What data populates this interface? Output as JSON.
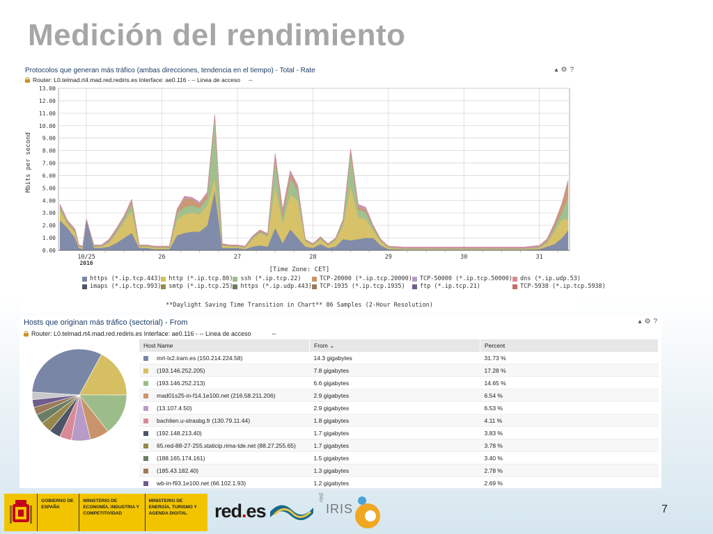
{
  "slide": {
    "title": "Medición del rendimiento",
    "page_number": "7"
  },
  "panel1": {
    "title": "Protocolos que generan más tráfico (ambas direcciones, tendencia en el tiempo) - Total - Rate",
    "router": "Router: L0.telmad.rt4.mad.red.rediris.es Interface: ae0.116 - -- Linea de acceso",
    "router_extra": "--",
    "tools": [
      "▴",
      "⚙",
      "?"
    ]
  },
  "chart_data": {
    "type": "area",
    "ylabel": "Mbits per second",
    "xlabel": "[Time Zone: CET]",
    "note": "**Daylight Saving Time Transition in Chart** 86 Samples (2-Hour Resolution)",
    "ylim": [
      0,
      13
    ],
    "yticks": [
      "0.00",
      "1.00",
      "2.00",
      "3.00",
      "4.00",
      "5.00",
      "6.00",
      "7.00",
      "8.00",
      "9.00",
      "10.00",
      "11.00",
      "12.00",
      "13.00"
    ],
    "xticks": [
      {
        "t": 0,
        "label": "10/25",
        "sub": "2016"
      },
      {
        "t": 1,
        "label": "26"
      },
      {
        "t": 2,
        "label": "27"
      },
      {
        "t": 3,
        "label": "28"
      },
      {
        "t": 4,
        "label": "29"
      },
      {
        "t": 5,
        "label": "30"
      },
      {
        "t": 6,
        "label": "31"
      }
    ],
    "x": [
      -0.35,
      -0.25,
      -0.15,
      -0.1,
      -0.05,
      0.0,
      0.1,
      0.2,
      0.3,
      0.4,
      0.5,
      0.6,
      0.7,
      0.8,
      0.9,
      1.0,
      1.1,
      1.2,
      1.3,
      1.4,
      1.5,
      1.6,
      1.7,
      1.8,
      1.9,
      2.0,
      2.1,
      2.2,
      2.3,
      2.4,
      2.5,
      2.6,
      2.7,
      2.8,
      2.9,
      3.0,
      3.1,
      3.2,
      3.3,
      3.4,
      3.5,
      3.6,
      3.7,
      3.8,
      3.9,
      4.0,
      4.2,
      4.4,
      4.6,
      4.8,
      5.0,
      5.2,
      5.4,
      5.6,
      5.8,
      6.0,
      6.1,
      6.2,
      6.3,
      6.38
    ],
    "series": [
      {
        "name": "https (*.ip.tcp.443)",
        "color": "#7a86a6",
        "values": [
          2.4,
          1.8,
          1.0,
          0.2,
          0.1,
          2.5,
          0.2,
          0.2,
          0.3,
          0.6,
          1.0,
          1.4,
          0.2,
          0.2,
          0.1,
          0.1,
          0.1,
          1.2,
          1.4,
          1.5,
          1.5,
          2.0,
          4.8,
          0.2,
          0.2,
          0.2,
          0.1,
          0.3,
          0.4,
          0.3,
          1.8,
          0.6,
          1.7,
          1.0,
          0.3,
          0.2,
          0.5,
          0.2,
          0.3,
          0.9,
          0.8,
          0.9,
          1.0,
          1.0,
          0.4,
          0.1,
          0.05,
          0.05,
          0.05,
          0.05,
          0.05,
          0.05,
          0.05,
          0.05,
          0.05,
          0.1,
          0.3,
          0.5,
          1.0,
          1.6
        ]
      },
      {
        "name": "http (*.ip.tcp.80)",
        "color": "#d6bf62",
        "values": [
          0.8,
          0.3,
          0.4,
          0.1,
          0.1,
          0.0,
          0.1,
          0.1,
          0.3,
          0.8,
          1.3,
          1.8,
          0.1,
          0.1,
          0.1,
          0.1,
          0.1,
          1.3,
          1.5,
          1.5,
          1.4,
          1.6,
          1.0,
          0.2,
          0.1,
          0.1,
          0.1,
          0.6,
          1.0,
          0.8,
          3.4,
          1.6,
          2.8,
          3.0,
          0.4,
          0.2,
          0.4,
          0.2,
          0.5,
          1.1,
          4.4,
          1.8,
          1.5,
          0.6,
          0.3,
          0.1,
          0.05,
          0.05,
          0.05,
          0.05,
          0.05,
          0.05,
          0.05,
          0.05,
          0.05,
          0.1,
          0.3,
          1.0,
          1.5,
          0.9
        ]
      },
      {
        "name": "ssh (*.ip.tcp.22)",
        "color": "#9cbd8a",
        "values": [
          0.3,
          0.1,
          0.1,
          0.05,
          0.05,
          0.0,
          0.05,
          0.05,
          0.1,
          0.2,
          0.3,
          0.6,
          0.05,
          0.05,
          0.05,
          0.05,
          0.05,
          0.5,
          0.6,
          0.6,
          0.5,
          0.6,
          4.9,
          0.05,
          0.05,
          0.05,
          0.05,
          0.1,
          0.1,
          0.1,
          2.2,
          0.5,
          1.3,
          0.8,
          0.1,
          0.05,
          0.1,
          0.05,
          0.1,
          0.3,
          2.6,
          0.6,
          0.6,
          0.2,
          0.1,
          0.05,
          0.05,
          0.05,
          0.05,
          0.05,
          0.05,
          0.05,
          0.05,
          0.05,
          0.05,
          0.05,
          0.1,
          0.3,
          0.6,
          1.8
        ]
      },
      {
        "name": "TCP-20000 (*.ip.tcp.20000)",
        "color": "#c9946c",
        "values": [
          0.1,
          0.1,
          0.1,
          0.05,
          0.05,
          0.0,
          0.05,
          0.05,
          0.1,
          0.1,
          0.1,
          0.2,
          0.05,
          0.05,
          0.05,
          0.05,
          0.05,
          0.2,
          0.7,
          0.5,
          0.3,
          0.3,
          0.1,
          0.05,
          0.05,
          0.05,
          0.05,
          0.05,
          0.05,
          0.05,
          0.2,
          0.3,
          0.3,
          0.2,
          0.05,
          0.05,
          0.05,
          0.05,
          0.05,
          0.1,
          0.2,
          0.2,
          0.2,
          0.1,
          0.05,
          0.05,
          0.02,
          0.02,
          0.02,
          0.02,
          0.02,
          0.02,
          0.02,
          0.02,
          0.02,
          0.05,
          0.1,
          0.3,
          0.6,
          1.2
        ]
      },
      {
        "name": "TCP-50000 (*.ip.tcp.50000)",
        "color": "#b79bc6",
        "values": [
          0.05,
          0.05,
          0.05,
          0.02,
          0.02,
          0.0,
          0.02,
          0.02,
          0.05,
          0.05,
          0.05,
          0.05,
          0.02,
          0.02,
          0.02,
          0.02,
          0.02,
          0.05,
          0.1,
          0.1,
          0.1,
          0.1,
          0.05,
          0.02,
          0.02,
          0.02,
          0.02,
          0.05,
          0.05,
          0.05,
          0.1,
          0.1,
          0.1,
          0.1,
          0.02,
          0.02,
          0.02,
          0.02,
          0.02,
          0.05,
          0.1,
          0.1,
          0.1,
          0.05,
          0.02,
          0.02,
          0.05,
          0.05,
          0.05,
          0.05,
          0.05,
          0.05,
          0.05,
          0.05,
          0.05,
          0.05,
          0.05,
          0.05,
          0.05,
          0.05
        ]
      },
      {
        "name": "dns (*.ip.udp.53)",
        "color": "#d98a96",
        "values": [
          0.05,
          0.05,
          0.05,
          0.02,
          0.02,
          0.0,
          0.02,
          0.02,
          0.05,
          0.05,
          0.05,
          0.05,
          0.02,
          0.02,
          0.02,
          0.02,
          0.02,
          0.05,
          0.05,
          0.05,
          0.05,
          0.05,
          0.05,
          0.02,
          0.02,
          0.02,
          0.02,
          0.05,
          0.05,
          0.05,
          0.1,
          0.2,
          0.2,
          0.1,
          0.02,
          0.02,
          0.02,
          0.02,
          0.02,
          0.05,
          0.05,
          0.1,
          0.05,
          0.05,
          0.02,
          0.02,
          0.05,
          0.05,
          0.05,
          0.05,
          0.05,
          0.05,
          0.05,
          0.05,
          0.05,
          0.05,
          0.05,
          0.05,
          0.05,
          0.05
        ]
      },
      {
        "name": "imaps (*.ip.tcp.993)",
        "color": "#4d5566",
        "values": []
      },
      {
        "name": "smtp (*.ip.tcp.25)",
        "color": "#96884a",
        "values": []
      },
      {
        "name": "https (*.ip.udp.443)",
        "color": "#6b7d63",
        "values": []
      },
      {
        "name": "TCP-1935 (*.ip.tcp.1935)",
        "color": "#9a7a5a",
        "values": []
      },
      {
        "name": "ftp (*.ip.tcp.21)",
        "color": "#6e5c8e",
        "values": []
      },
      {
        "name": "TCP-5938 (*.ip.tcp.5938)",
        "color": "#c26e6e",
        "values": []
      }
    ]
  },
  "panel2": {
    "title": "Hosts que originan más tráfico (sectorial) - From",
    "router": "Router: L0.telmad.rt4.mad.red.rediris.es Interface: ae0.116 - -- Linea de acceso",
    "router_extra": "--",
    "tools": [
      "▴",
      "⚙",
      "?"
    ],
    "columns": [
      "Host Name",
      "From ⌄",
      "Percent"
    ],
    "rows": [
      {
        "host": "mrt-lx2.iram.es (150.214.224.58)",
        "from": "14.3 gigabytes",
        "percent": "31.73 %",
        "color": "#7a86a6",
        "value": 31.73
      },
      {
        "host": "(193.146.252.205)",
        "from": "7.8 gigabytes",
        "percent": "17.28 %",
        "color": "#d6bf62",
        "value": 17.28
      },
      {
        "host": "(193.146.252.213)",
        "from": "6.6 gigabytes",
        "percent": "14.65 %",
        "color": "#9cbd8a",
        "value": 14.65
      },
      {
        "host": "mad01s25-in-f14.1e100.net (216.58.211.206)",
        "from": "2.9 gigabytes",
        "percent": "6.54 %",
        "color": "#c9946c",
        "value": 6.54
      },
      {
        "host": "(13.107.4.50)",
        "from": "2.9 gigabytes",
        "percent": "6.53 %",
        "color": "#b79bc6",
        "value": 6.53
      },
      {
        "host": "bachlien.u-strasbg.fr (130.79.11.44)",
        "from": "1.8 gigabytes",
        "percent": "4.11 %",
        "color": "#d98a96",
        "value": 4.11
      },
      {
        "host": "(192.148.213.40)",
        "from": "1.7 gigabytes",
        "percent": "3.83 %",
        "color": "#4d5566",
        "value": 3.83
      },
      {
        "host": "65.red-88-27-255.staticip.rima-tde.net (88.27.255.65)",
        "from": "1.7 gigabytes",
        "percent": "3.78 %",
        "color": "#96884a",
        "value": 3.78
      },
      {
        "host": "(188.165.174.161)",
        "from": "1.5 gigabytes",
        "percent": "3.40 %",
        "color": "#6b7d63",
        "value": 3.4
      },
      {
        "host": "(185.43.182.40)",
        "from": "1.3 gigabytes",
        "percent": "2.78 %",
        "color": "#9a7a5a",
        "value": 2.78
      },
      {
        "host": "wb-in-f93.1e100.net (66.102.1.93)",
        "from": "1.2 gigabytes",
        "percent": "2.69 %",
        "color": "#6e5c8e",
        "value": 2.69
      }
    ]
  },
  "footer": {
    "gov_label": "GOBIERNO DE ESPAÑA",
    "ministry1": "MINISTERIO DE ECONOMÍA, INDUSTRIA Y COMPETITIVIDAD",
    "ministry2": "MINISTERIO DE ENERGÍA, TURISMO Y AGENDA DIGITAL",
    "redes_a": "red",
    "redes_dot": ".",
    "redes_b": "es",
    "rediris_small": "red",
    "rediris": "IRIS"
  }
}
